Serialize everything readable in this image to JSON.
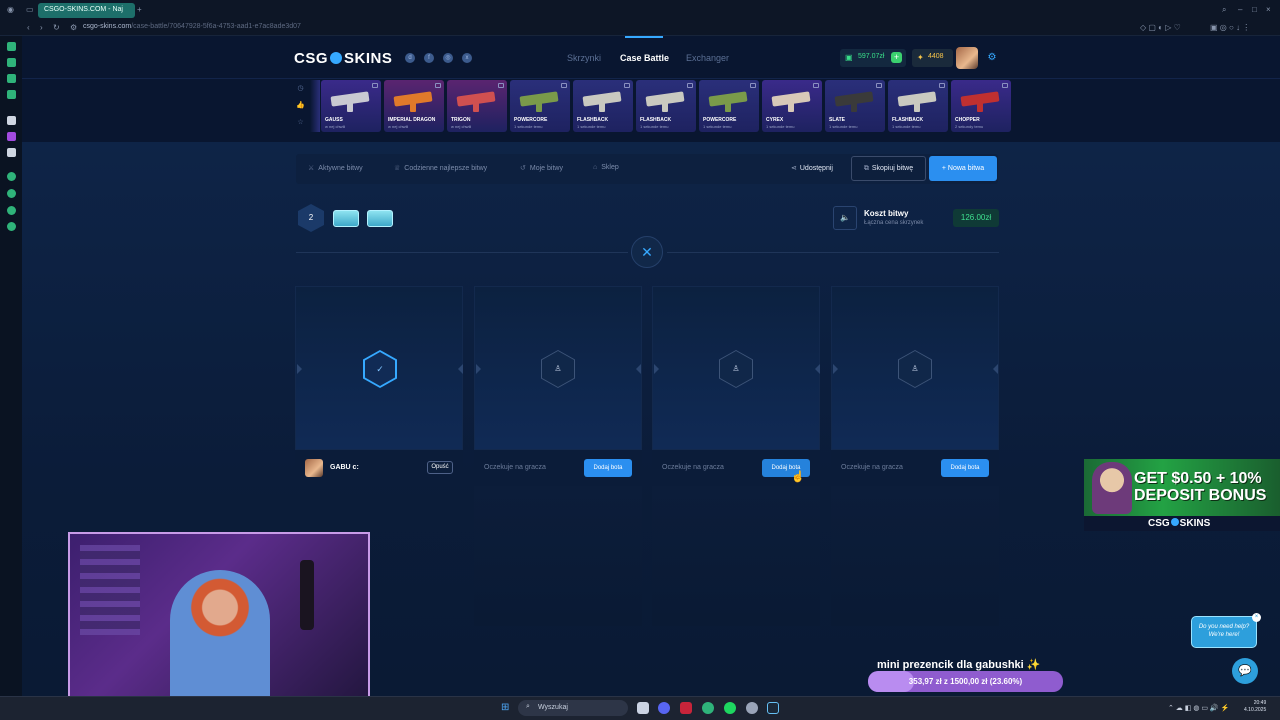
{
  "browser": {
    "tab_title": "CSGO-SKINS.COM - Naj",
    "url_host": "csgo-skins.com",
    "url_path": "/case-battle/70647928-5f6a-4753-aad1-e7ac8ade3d07"
  },
  "header": {
    "logo_left": "CSG",
    "logo_right": "SKINS",
    "nav": [
      "Skrzynki",
      "Case Battle",
      "Exchanger"
    ],
    "balance": "597.07zł",
    "points": "4408"
  },
  "drops": [
    {
      "name": "GAUSS",
      "sub": "w nej chwili",
      "bg": "#3a2a8a",
      "gun": "#c9c9d2"
    },
    {
      "name": "IMPERIAL DRAGON",
      "sub": "w nej chwili",
      "bg": "#5a2470",
      "gun": "#e07a2a"
    },
    {
      "name": "TRIGON",
      "sub": "w nej chwili",
      "bg": "#5a2470",
      "gun": "#d05050"
    },
    {
      "name": "POWERCORE",
      "sub": "1 sekunde temu",
      "bg": "#2a2f7a",
      "gun": "#7a9a4a"
    },
    {
      "name": "FLASHBACK",
      "sub": "1 sekunde temu",
      "bg": "#2a2f7a",
      "gun": "#c9c9c0"
    },
    {
      "name": "FLASHBACK",
      "sub": "1 sekunde temu",
      "bg": "#2a2f7a",
      "gun": "#c9c9c0"
    },
    {
      "name": "POWERCORE",
      "sub": "1 sekunde temu",
      "bg": "#2a2f7a",
      "gun": "#7a9a4a"
    },
    {
      "name": "CYREX",
      "sub": "1 sekunde temu",
      "bg": "#3a2a8a",
      "gun": "#d8c8b8"
    },
    {
      "name": "SLATE",
      "sub": "1 sekunde temu",
      "bg": "#2a2f7a",
      "gun": "#3a3a3a"
    },
    {
      "name": "FLASHBACK",
      "sub": "1 sekunde temu",
      "bg": "#2a2f7a",
      "gun": "#c9c9c0"
    },
    {
      "name": "CHOPPER",
      "sub": "2 sekundy temu",
      "bg": "#3a2a8a",
      "gun": "#c03030"
    }
  ],
  "toolbar": {
    "active": "Aktywne bitwy",
    "best": "Codzienne najlepsze bitwy",
    "mine": "Moje bitwy",
    "shop": "Sklep",
    "share": "Udostępnij",
    "copy": "Skopiuj bitwę",
    "new": "+ Nowa bitwa"
  },
  "battle": {
    "rounds": "2",
    "cost_title": "Koszt bitwy",
    "cost_sub": "Łączna cena skrzynek",
    "cost_value": "126.00zł",
    "player_name": "GABU c:",
    "leave": "Opuść",
    "waiting": "Oczekuje na gracza",
    "add_bot": "Dodaj bota"
  },
  "promo": {
    "line1": "GET $0.50 + 10%",
    "line2": "DEPOSIT BONUS",
    "brand_left": "CSG",
    "brand_right": "SKINS"
  },
  "goal": {
    "title": "mini prezencik dla gabushki ✨",
    "text": "353,97 zł z 1500,00 zł (23.60%)",
    "progress": 0.236
  },
  "help": {
    "text1": "Do you need help?",
    "text2": "We're here!"
  },
  "taskbar": {
    "search": "Wyszukaj",
    "time": "20:49",
    "date": "4.10.2025"
  }
}
